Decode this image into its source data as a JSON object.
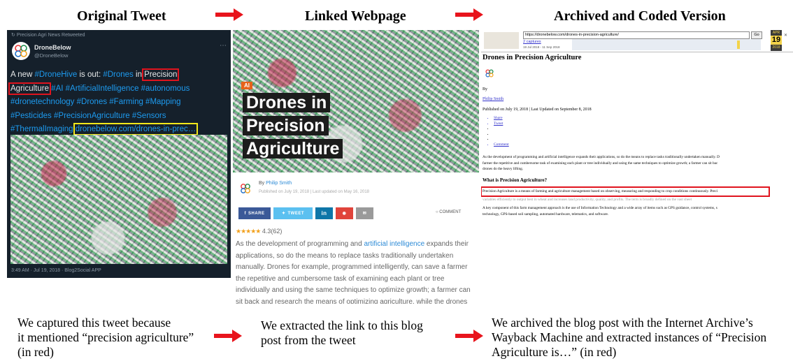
{
  "headers": {
    "original_tweet": "Original Tweet",
    "linked_webpage": "Linked Webpage",
    "archived_version": "Archived and Coded Version"
  },
  "captions": {
    "tweet": [
      "We captured this tweet because",
      "it mentioned “precision agriculture”",
      "(in red)"
    ],
    "webpage": [
      "We extracted the link to this blog",
      "post from the tweet"
    ],
    "archive": [
      "We archived the blog post with the Internet Archive’s",
      "Wayback Machine and extracted instances of “Precision",
      "Agriculture is…” (in red)"
    ]
  },
  "tweet": {
    "retweet_line": "Precision Agri News Retweeted",
    "display_name": "DroneBelow",
    "handle": "@DroneBelow",
    "text_lines": [
      [
        "A new ",
        "#DroneHive",
        " is out: ",
        "#Drones",
        " in ",
        "Precision"
      ],
      [
        "Agriculture",
        " ",
        "#AI #ArtificialIntelligence #autonomous"
      ],
      [
        "#dronetechnology #Drones #Farming #Mapping"
      ],
      [
        "#Pesticides #PrecisionAgriculture #Sensors"
      ],
      [
        "#ThermalImaging",
        " ",
        "dronebelow.com/drones-in-prec…"
      ]
    ],
    "timestamp": "3:49 AM · Jul 19, 2018 · Blog2Social APP",
    "colors": {
      "highlight_red": "#e0141e",
      "link_box_yellow": "#f2e81a",
      "link_blue": "#1d9bf0",
      "background": "#15202b"
    }
  },
  "webpage": {
    "badge": "AI",
    "hero_title_lines": [
      "Drones in",
      "Precision",
      "Agriculture"
    ],
    "by_label": "By",
    "author": "Philip Smith",
    "published": "Published on July 19, 2018 | Last updated on May 16, 2018",
    "share_buttons": [
      "SHARE",
      "TWEET",
      "in",
      "",
      ""
    ],
    "comment_label": "COMMENT",
    "rating_value": "4.3(62)",
    "stars": 4.3,
    "body_lines": [
      [
        "As the development of programming and ",
        "artificial intelligence",
        " expands their"
      ],
      [
        "applications, so do the means to replace tasks traditionally undertaken"
      ],
      [
        "manually. Drones for example, programmed intelligently, can save a farmer"
      ],
      [
        "the repetitive and cumbersome task of examining each plant or tree"
      ],
      [
        "individually and using the same techniques to optimize growth; a farmer can"
      ],
      [
        "sit back and research the means of optimizing agriculture, while the drones"
      ]
    ]
  },
  "archive": {
    "wayback_url": "https://dronebelow.com/drones-in-precision-agriculture/",
    "go_label": "Go",
    "captures_label": "2 captures",
    "capture_dates": "19 Jul 2018 - 11 Sep 2018",
    "calendar": {
      "month": "APR",
      "day": "19",
      "year": "2018"
    },
    "title": "Drones in Precision Agriculture",
    "by_label": "By",
    "author": "Philip Smith",
    "published": "Published on July 19, 2018 | Last Updated on September 8, 2018",
    "bullets": [
      "Share",
      "Tweet",
      "",
      "",
      "",
      "Comment"
    ],
    "para1": [
      "As the development of programming and artificial intelligence expands their applications, so do the means to replace tasks traditionally undertaken manually. D",
      "farmer the repetitive and cumbersome task of examining each plant or tree individually and using the same techniques to optimize growth; a farmer can sit bac",
      "drones do the heavy lifting."
    ],
    "subheading": "What is Precision Agriculture?",
    "para2": [
      "Precision Agriculture is a means of farming and agriculture management based on observing, measuring and responding to crop conditions continuously. Preci",
      "variables efficiently to output best in wheat and increases land productivity, quality, and profits. The term is broadly defined on the vast sheet"
    ],
    "para3": [
      "A key component of this farm management approach is the use of Information Technology and a wide array of items such as GPS guidance, control systems, s",
      "technology, GPS-based soil sampling, automated hardware, telematics, and software."
    ],
    "colors": {
      "highlight_red": "#e0141e"
    }
  },
  "colors": {
    "arrow_red": "#e8141c"
  }
}
